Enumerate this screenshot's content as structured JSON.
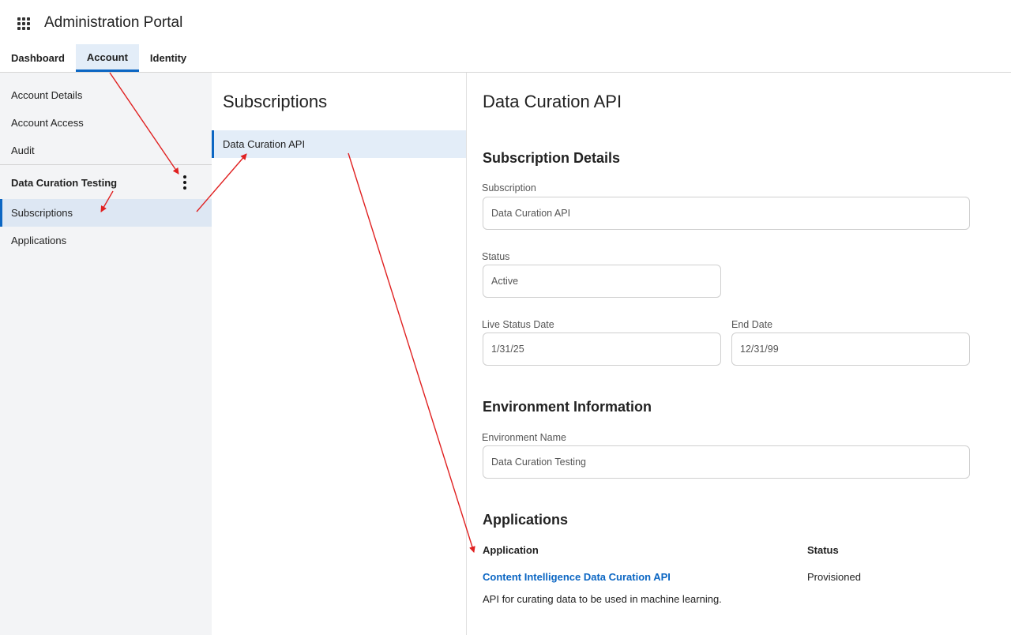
{
  "header": {
    "app_title": "Administration Portal",
    "app_icon": "app-grid-icon",
    "tabs": [
      {
        "label": "Dashboard",
        "active": false
      },
      {
        "label": "Account",
        "active": true
      },
      {
        "label": "Identity",
        "active": false
      }
    ]
  },
  "leftnav": {
    "items": [
      {
        "label": "Account Details"
      },
      {
        "label": "Account Access"
      },
      {
        "label": "Audit"
      }
    ],
    "group": {
      "label": "Data Curation Testing",
      "menu_icon": "kebab-menu-icon",
      "items": [
        {
          "label": "Subscriptions",
          "selected": true
        },
        {
          "label": "Applications",
          "selected": false
        }
      ]
    }
  },
  "subscriptions": {
    "title": "Subscriptions",
    "items": [
      {
        "label": "Data Curation API",
        "selected": true
      }
    ]
  },
  "detail": {
    "title": "Data Curation API",
    "subscription_details": {
      "heading": "Subscription Details",
      "subscription_label": "Subscription",
      "subscription_value": "Data Curation API",
      "status_label": "Status",
      "status_value": "Active",
      "live_date_label": "Live Status Date",
      "live_date_value": "1/31/25",
      "end_date_label": "End Date",
      "end_date_value": "12/31/99"
    },
    "environment": {
      "heading": "Environment Information",
      "name_label": "Environment Name",
      "name_value": "Data Curation Testing"
    },
    "applications": {
      "heading": "Applications",
      "columns": [
        "Application",
        "Status"
      ],
      "rows": [
        {
          "name": "Content Intelligence Data Curation API",
          "description": "API for curating data to be used in machine learning.",
          "status": "Provisioned"
        }
      ]
    }
  },
  "colors": {
    "accent": "#0b66c3",
    "selected_bg": "#e3edf8",
    "nav_bg": "#f3f4f6",
    "annotation_arrow": "#e02020"
  }
}
